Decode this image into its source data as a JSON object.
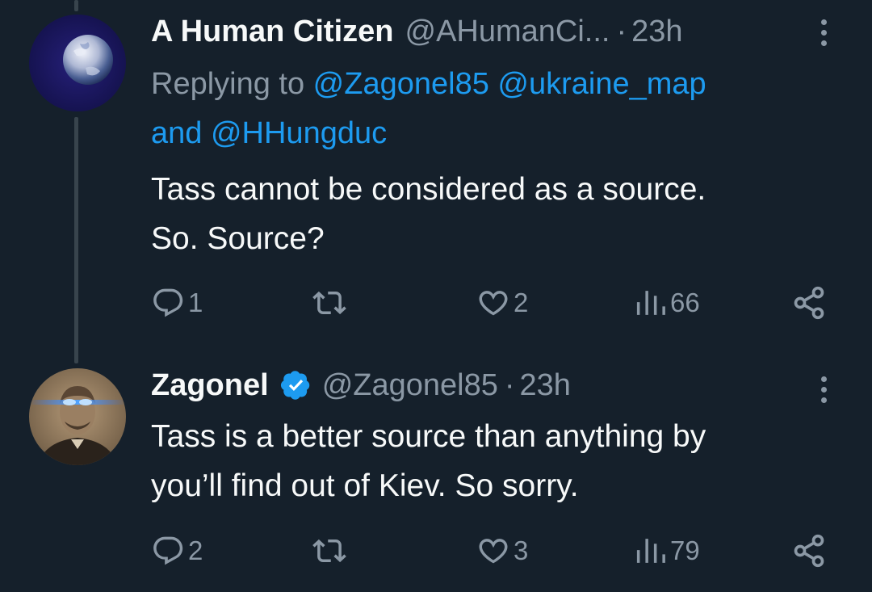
{
  "tweets": [
    {
      "author": {
        "name": "A Human Citizen",
        "handle": "@AHumanCi...",
        "separator": "·",
        "time": "23h",
        "avatar": "earth-moon-avatar"
      },
      "reply_to": {
        "prefix": "Replying to ",
        "mentions": [
          "@Zagonel85",
          "@ukraine_map",
          "@HHungduc"
        ],
        "joiner": "and"
      },
      "text_lines": [
        "Tass cannot be considered as a source.",
        "So. Source?"
      ],
      "stats": {
        "replies": "1",
        "reposts": "",
        "likes": "2",
        "views": "66"
      }
    },
    {
      "author": {
        "name": "Zagonel",
        "verified": true,
        "handle": "@Zagonel85",
        "separator": "·",
        "time": "23h",
        "avatar": "portrait-laser-eyes-avatar"
      },
      "text_lines": [
        "Tass is a better source than anything by",
        "you’ll find out of Kiev. So sorry."
      ],
      "stats": {
        "replies": "2",
        "reposts": "",
        "likes": "3",
        "views": "79"
      }
    }
  ],
  "colors": {
    "background": "#15202b",
    "primary_text": "#f7f9f9",
    "secondary_text": "#8b98a5",
    "accent": "#1d9bf0",
    "thread_line": "#38444d"
  },
  "icons": [
    "reply-icon",
    "repost-icon",
    "like-icon",
    "views-icon",
    "share-icon",
    "more-icon",
    "verified-badge-icon"
  ]
}
